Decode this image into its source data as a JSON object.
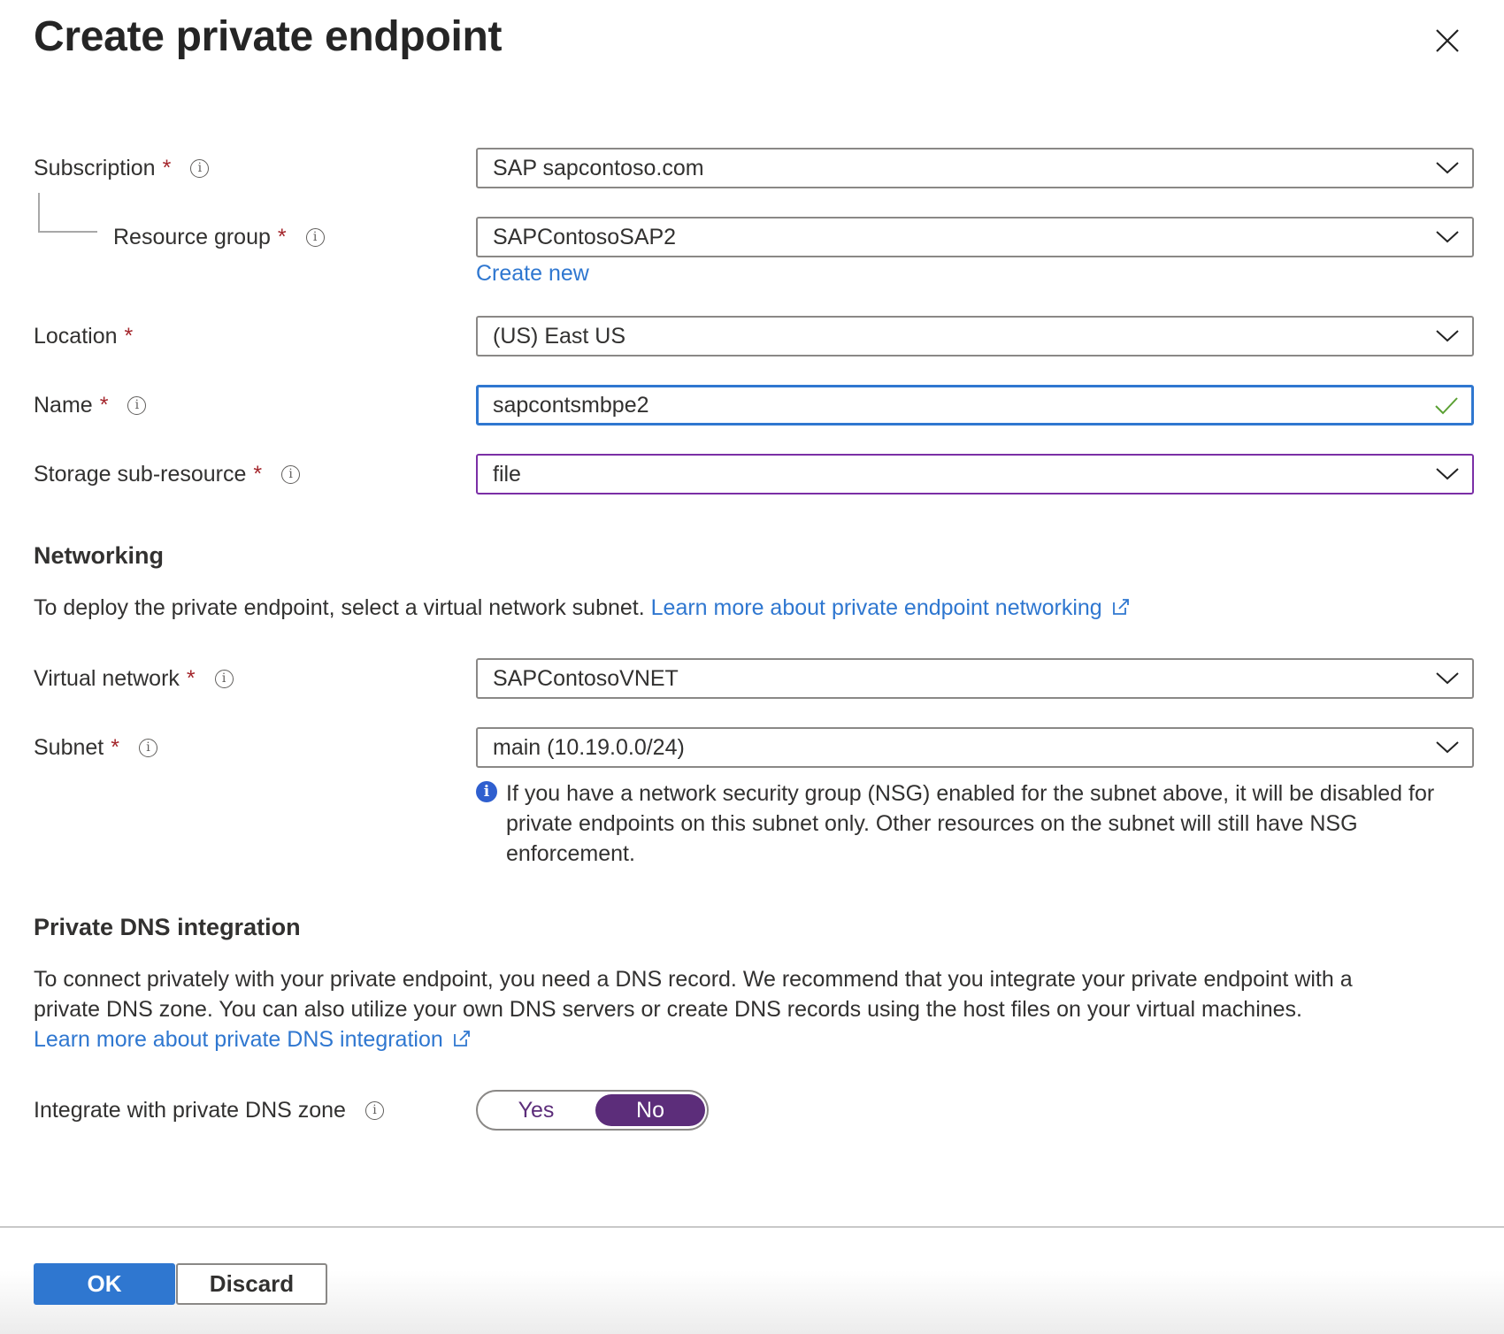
{
  "dialog": {
    "title": "Create private endpoint",
    "close_icon": "close-icon"
  },
  "colors": {
    "accent": "#2f77d0",
    "required": "#a4262c",
    "toggle_selected": "#5c2d7a",
    "valid": "#5aa032",
    "focus_border": "#2f77d0",
    "purple_border": "#7b2fa6"
  },
  "fields": {
    "subscription": {
      "label": "Subscription",
      "required": "*",
      "value": "SAP sapcontoso.com"
    },
    "resource_group": {
      "label": "Resource group",
      "required": "*",
      "value": "SAPContosoSAP2",
      "create_new": "Create new"
    },
    "location": {
      "label": "Location",
      "required": "*",
      "value": "(US) East US"
    },
    "name": {
      "label": "Name",
      "required": "*",
      "value": "sapcontsmbpe2"
    },
    "storage_sub_resource": {
      "label": "Storage sub-resource",
      "required": "*",
      "value": "file"
    }
  },
  "networking": {
    "heading": "Networking",
    "description": "To deploy the private endpoint, select a virtual network subnet.",
    "learn_more": "Learn more about private endpoint networking",
    "virtual_network": {
      "label": "Virtual network",
      "required": "*",
      "value": "SAPContosoVNET"
    },
    "subnet": {
      "label": "Subnet",
      "required": "*",
      "value": "main (10.19.0.0/24)"
    },
    "nsg_info": {
      "line1": "If you have a network security group (NSG) enabled for the subnet above, it will be disabled for",
      "line2": "private endpoints on this subnet only. Other resources on the subnet will still have NSG",
      "line3": "enforcement."
    }
  },
  "dns": {
    "heading": "Private DNS integration",
    "para_line1": "To connect privately with your private endpoint, you need a DNS record. We recommend that you integrate your private endpoint with a",
    "para_line2": "private DNS zone. You can also utilize your own DNS servers or create DNS records using the host files on your virtual machines.",
    "learn_more": "Learn more about private DNS integration",
    "integrate": {
      "label": "Integrate with private DNS zone",
      "options": [
        "Yes",
        "No"
      ],
      "selected": "No"
    }
  },
  "footer": {
    "ok_label": "OK",
    "discard_label": "Discard"
  }
}
